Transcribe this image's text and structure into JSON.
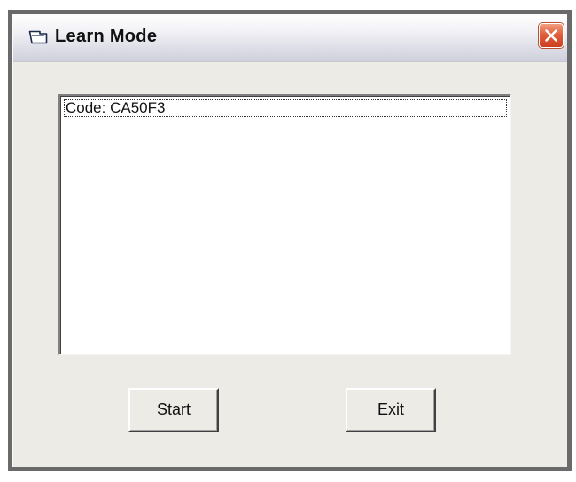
{
  "window": {
    "title": "Learn Mode",
    "icon": "window-icon",
    "close_icon": "close-icon"
  },
  "listbox": {
    "items": [
      {
        "label": "Code: CA50F3",
        "selected": true
      }
    ]
  },
  "buttons": {
    "start_label": "Start",
    "exit_label": "Exit"
  },
  "colors": {
    "face": "#ecebe6",
    "close_accent": "#e0603c",
    "list_background": "#ffffff"
  }
}
